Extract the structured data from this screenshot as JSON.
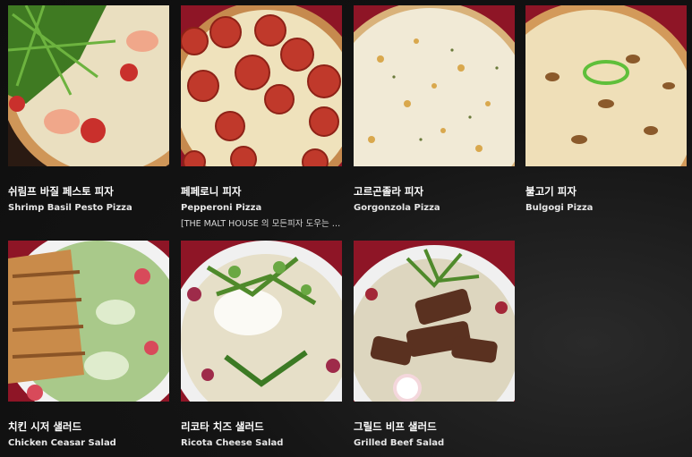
{
  "menu": {
    "items": [
      {
        "name_ko": "쉬림프 바질 페스토 피자",
        "name_en": "Shrimp Basil Pesto Pizza",
        "desc": ""
      },
      {
        "name_ko": "페페로니 피자",
        "name_en": "Pepperoni Pizza",
        "desc": "[THE MALT HOUSE 의 모든피자 도우는 매..."
      },
      {
        "name_ko": "고르곤졸라 피자",
        "name_en": "Gorgonzola Pizza",
        "desc": ""
      },
      {
        "name_ko": "불고기 피자",
        "name_en": "Bulgogi Pizza",
        "desc": ""
      },
      {
        "name_ko": "치킨 시저 샐러드",
        "name_en": "Chicken Ceasar Salad",
        "desc": ""
      },
      {
        "name_ko": "리코타 치즈 샐러드",
        "name_en": "Ricota Cheese Salad",
        "desc": ""
      },
      {
        "name_ko": "그릴드 비프 샐러드",
        "name_en": "Grilled Beef Salad",
        "desc": ""
      }
    ]
  },
  "colors": {
    "background": "#101010",
    "tablecloth_red": "#9e1b2b",
    "crust": "#d8a56b",
    "cheese": "#efe6c8",
    "pepperoni": "#c0392b",
    "greens": "#4f8a2b"
  }
}
